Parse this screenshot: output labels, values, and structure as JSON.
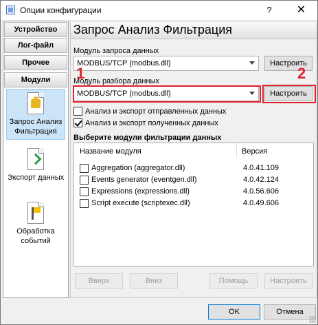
{
  "window": {
    "title": "Опции конфигурации",
    "help_label": "?",
    "close_label": "✕"
  },
  "nav": {
    "headers": [
      "Устройство",
      "Лог-файл",
      "Прочее",
      "Модули"
    ],
    "items": [
      {
        "label": "Запрос Анализ Фильтрация",
        "icon": "puzzle-icon",
        "active": true
      },
      {
        "label": "Экспорт данных",
        "icon": "export-icon",
        "active": false
      },
      {
        "label": "Обработка событий",
        "icon": "event-flag-icon",
        "active": false
      }
    ]
  },
  "panel": {
    "title": "Запрос Анализ Фильтрация",
    "query_module_label": "Модуль запроса данных",
    "query_module_value": "MODBUS/TCP (modbus.dll)",
    "query_config_label": "Настроить",
    "parser_module_label": "Модуль разбора данных",
    "parser_module_value": "MODBUS/TCP (modbus.dll)",
    "parser_config_label": "Настроить",
    "check_sent_label": "Анализ и экспорт отправленных данных",
    "check_sent": false,
    "check_received_label": "Анализ и экспорт полученных данных",
    "check_received": true,
    "filter_section_title": "Выберите модули фильтрации данных",
    "columns": [
      "Название модуля",
      "Версия"
    ],
    "filters": [
      {
        "name": "Aggregation (aggregator.dll)",
        "version": "4.0.41.109",
        "checked": false
      },
      {
        "name": "Events generator (eventgen.dll)",
        "version": "4.0.42.124",
        "checked": false
      },
      {
        "name": "Expressions (expressions.dll)",
        "version": "4.0.56.606",
        "checked": false
      },
      {
        "name": "Script execute (scriptexec.dll)",
        "version": "4.0.49.606",
        "checked": false
      }
    ],
    "buttons": {
      "up": "Вверх",
      "down": "Вниз",
      "help": "Помощь",
      "configure": "Настроить"
    }
  },
  "annotations": {
    "one": "1",
    "two": "2",
    "color": "#e0242c"
  },
  "footer": {
    "ok": "OK",
    "cancel": "Отмена"
  }
}
